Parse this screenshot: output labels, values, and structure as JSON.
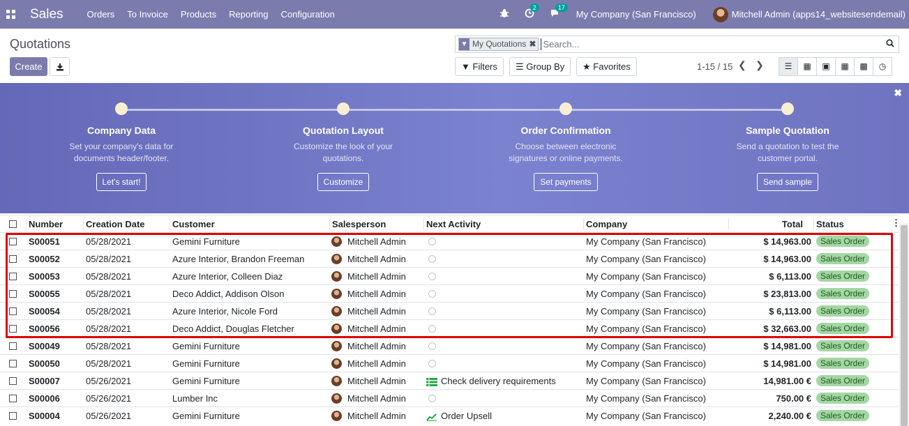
{
  "nav": {
    "app_name": "Sales",
    "menu": [
      "Orders",
      "To Invoice",
      "Products",
      "Reporting",
      "Configuration"
    ],
    "activity_count": "2",
    "message_count": "17",
    "company": "My Company (San Francisco)",
    "user": "Mitchell Admin (apps14_websitesendemail)"
  },
  "control": {
    "breadcrumb": "Quotations",
    "create": "Create",
    "facet": "My Quotations",
    "search_placeholder": "Search...",
    "filters": "Filters",
    "groupby": "Group By",
    "favorites": "Favorites",
    "pager": "1-15 / 15"
  },
  "banner": {
    "steps": [
      {
        "title": "Company Data",
        "desc1": "Set your company's data for",
        "desc2": "documents header/footer.",
        "button": "Let's start!"
      },
      {
        "title": "Quotation Layout",
        "desc1": "Customize the look of your",
        "desc2": "quotations.",
        "button": "Customize"
      },
      {
        "title": "Order Confirmation",
        "desc1": "Choose between electronic",
        "desc2": "signatures or online payments.",
        "button": "Set payments"
      },
      {
        "title": "Sample Quotation",
        "desc1": "Send a quotation to test the",
        "desc2": "customer portal.",
        "button": "Send sample"
      }
    ]
  },
  "table": {
    "headers": [
      "Number",
      "Creation Date",
      "Customer",
      "Salesperson",
      "Next Activity",
      "Company",
      "Total",
      "Status"
    ],
    "rows": [
      {
        "number": "S00051",
        "date": "05/28/2021",
        "customer": "Gemini Furniture",
        "salesperson": "Mitchell Admin",
        "activity": "",
        "company": "My Company (San Francisco)",
        "total": "$ 14,963.00",
        "status": "Sales Order"
      },
      {
        "number": "S00052",
        "date": "05/28/2021",
        "customer": "Azure Interior, Brandon Freeman",
        "salesperson": "Mitchell Admin",
        "activity": "",
        "company": "My Company (San Francisco)",
        "total": "$ 14,963.00",
        "status": "Sales Order"
      },
      {
        "number": "S00053",
        "date": "05/28/2021",
        "customer": "Azure Interior, Colleen Diaz",
        "salesperson": "Mitchell Admin",
        "activity": "",
        "company": "My Company (San Francisco)",
        "total": "$ 6,113.00",
        "status": "Sales Order"
      },
      {
        "number": "S00055",
        "date": "05/28/2021",
        "customer": "Deco Addict, Addison Olson",
        "salesperson": "Mitchell Admin",
        "activity": "",
        "company": "My Company (San Francisco)",
        "total": "$ 23,813.00",
        "status": "Sales Order"
      },
      {
        "number": "S00054",
        "date": "05/28/2021",
        "customer": "Azure Interior, Nicole Ford",
        "salesperson": "Mitchell Admin",
        "activity": "",
        "company": "My Company (San Francisco)",
        "total": "$ 6,113.00",
        "status": "Sales Order"
      },
      {
        "number": "S00056",
        "date": "05/28/2021",
        "customer": "Deco Addict, Douglas Fletcher",
        "salesperson": "Mitchell Admin",
        "activity": "",
        "company": "My Company (San Francisco)",
        "total": "$ 32,663.00",
        "status": "Sales Order"
      },
      {
        "number": "S00049",
        "date": "05/28/2021",
        "customer": "Gemini Furniture",
        "salesperson": "Mitchell Admin",
        "activity": "",
        "company": "My Company (San Francisco)",
        "total": "$ 14,981.00",
        "status": "Sales Order"
      },
      {
        "number": "S00050",
        "date": "05/28/2021",
        "customer": "Gemini Furniture",
        "salesperson": "Mitchell Admin",
        "activity": "",
        "company": "My Company (San Francisco)",
        "total": "$ 14,981.00",
        "status": "Sales Order"
      },
      {
        "number": "S00007",
        "date": "05/26/2021",
        "customer": "Gemini Furniture",
        "salesperson": "Mitchell Admin",
        "activity": "Check delivery requirements",
        "company": "My Company (San Francisco)",
        "total": "14,981.00 €",
        "status": "Sales Order"
      },
      {
        "number": "S00006",
        "date": "05/26/2021",
        "customer": "Lumber Inc",
        "salesperson": "Mitchell Admin",
        "activity": "",
        "company": "My Company (San Francisco)",
        "total": "750.00 €",
        "status": "Sales Order"
      },
      {
        "number": "S00004",
        "date": "05/26/2021",
        "customer": "Gemini Furniture",
        "salesperson": "Mitchell Admin",
        "activity": "Order Upsell",
        "company": "My Company (San Francisco)",
        "total": "2,240.00 €",
        "status": "Sales Order"
      }
    ]
  }
}
